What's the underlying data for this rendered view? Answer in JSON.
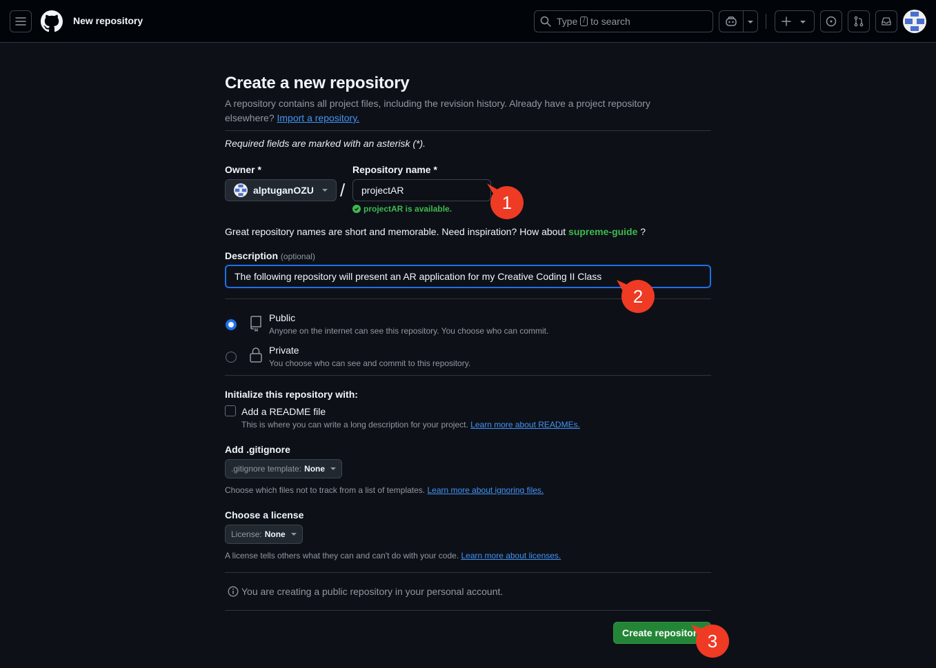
{
  "header": {
    "title": "New repository",
    "search_prefix": "Type",
    "search_key": "/",
    "search_suffix": "to search"
  },
  "form": {
    "title": "Create a new repository",
    "intro": "A repository contains all project files, including the revision history. Already have a project repository elsewhere?",
    "import_link": "Import a repository.",
    "required_note": "Required fields are marked with an asterisk (*).",
    "owner_label": "Owner *",
    "owner_value": "alptuganOZU",
    "slash": "/",
    "repo_label": "Repository name *",
    "repo_value": "projectAR",
    "availability": "projectAR is available.",
    "inspiration_text": "Great repository names are short and memorable. Need inspiration? How about",
    "suggestion": "supreme-guide",
    "suggestion_tail": "?",
    "description_label": "Description",
    "description_optional": "(optional)",
    "description_value": "The following repository will present an AR application for my Creative Coding II Class",
    "visibility": {
      "public_title": "Public",
      "public_sub": "Anyone on the internet can see this repository. You choose who can commit.",
      "private_title": "Private",
      "private_sub": "You choose who can see and commit to this repository.",
      "selected": "public"
    },
    "init_label": "Initialize this repository with:",
    "readme_label": "Add a README file",
    "readme_sub": "This is where you can write a long description for your project.",
    "readme_link": "Learn more about READMEs.",
    "readme_checked": false,
    "gitignore_label": "Add .gitignore",
    "gitignore_prefix": ".gitignore template:",
    "gitignore_value": "None",
    "gitignore_sub": "Choose which files not to track from a list of templates.",
    "gitignore_link": "Learn more about ignoring files.",
    "license_label": "Choose a license",
    "license_prefix": "License:",
    "license_value": "None",
    "license_sub": "A license tells others what they can and can't do with your code.",
    "license_link": "Learn more about licenses.",
    "info_note": "You are creating a public repository in your personal account.",
    "create_button": "Create repository"
  },
  "callouts": [
    "1",
    "2",
    "3"
  ],
  "colors": {
    "background": "#0d1117",
    "header": "#010409",
    "accent_blue": "#1f6feb",
    "success_green": "#3fb950",
    "button_green": "#238636",
    "callout_red": "#ef3a24"
  }
}
